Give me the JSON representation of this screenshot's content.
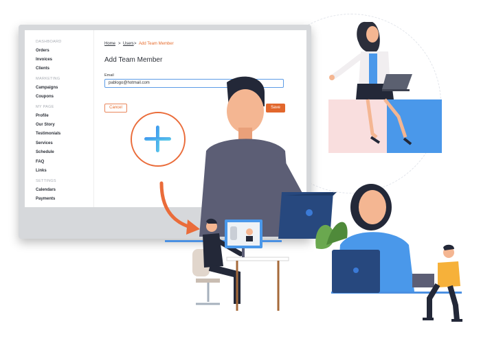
{
  "sidebar": {
    "sections": [
      {
        "title": "DASHBOARD",
        "items": [
          "Orders",
          "Invoices",
          "Clients"
        ]
      },
      {
        "title": "MARKETING",
        "items": [
          "Campaigns",
          "Coupons"
        ]
      },
      {
        "title": "MY PAGE",
        "items": [
          "Profile",
          "Our Story",
          "Testimonials",
          "Services",
          "Schedule",
          "FAQ",
          "Links"
        ]
      },
      {
        "title": "SETTINGS",
        "items": [
          "Calendars",
          "Payments"
        ]
      }
    ]
  },
  "breadcrumb": {
    "home": "Home",
    "users": "Users",
    "current": "Add Team Member",
    "separator": ">"
  },
  "form": {
    "title": "Add Team Member",
    "email_label": "Email",
    "email_value": "pablogo@hotmail.com",
    "cancel_label": "Cancel",
    "save_label": "Save"
  },
  "colors": {
    "accent_orange": "#e2672c",
    "accent_blue": "#4a90e2",
    "monitor_frame": "#d6d8db",
    "sidebar_text": "#2b2f37"
  },
  "icons": {
    "plus": "plus-icon",
    "arrow": "curved-arrow-icon"
  }
}
